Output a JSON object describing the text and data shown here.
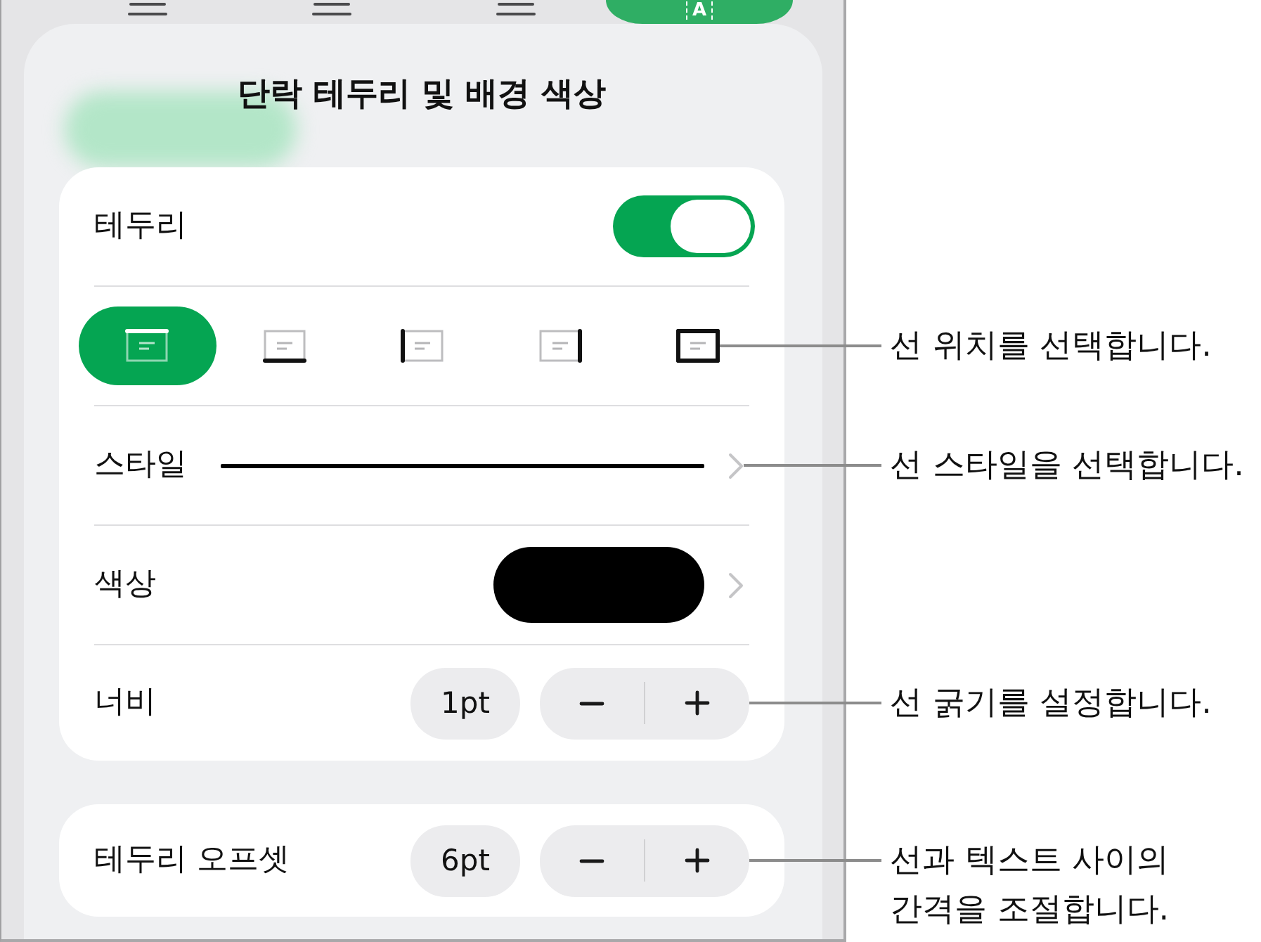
{
  "background_toolbar": {
    "buttons": [
      {
        "kind": "align",
        "selected": false
      },
      {
        "kind": "align",
        "selected": false
      },
      {
        "kind": "align",
        "selected": false
      },
      {
        "kind": "border",
        "label": "A",
        "selected": true
      }
    ]
  },
  "popover": {
    "title": "단락 테두리 및 배경 색상"
  },
  "border_card": {
    "border_toggle": {
      "label": "테두리",
      "on": true
    },
    "positions": {
      "items": [
        {
          "kind": "top",
          "selected": true
        },
        {
          "kind": "bottom",
          "selected": false
        },
        {
          "kind": "left",
          "selected": false
        },
        {
          "kind": "right",
          "selected": false
        },
        {
          "kind": "all",
          "selected": false
        }
      ],
      "callout": "선 위치를 선택합니다."
    },
    "style": {
      "label": "스타일",
      "callout": "선 스타일을 선택합니다."
    },
    "color": {
      "label": "색상",
      "color": "#000000"
    },
    "width": {
      "label": "너비",
      "value": "1pt",
      "callout": "선 굵기를 설정합니다."
    }
  },
  "offset_card": {
    "label": "테두리 오프셋",
    "value": "6pt",
    "callout": "선과 텍스트 사이의\n간격을 조절합니다."
  }
}
